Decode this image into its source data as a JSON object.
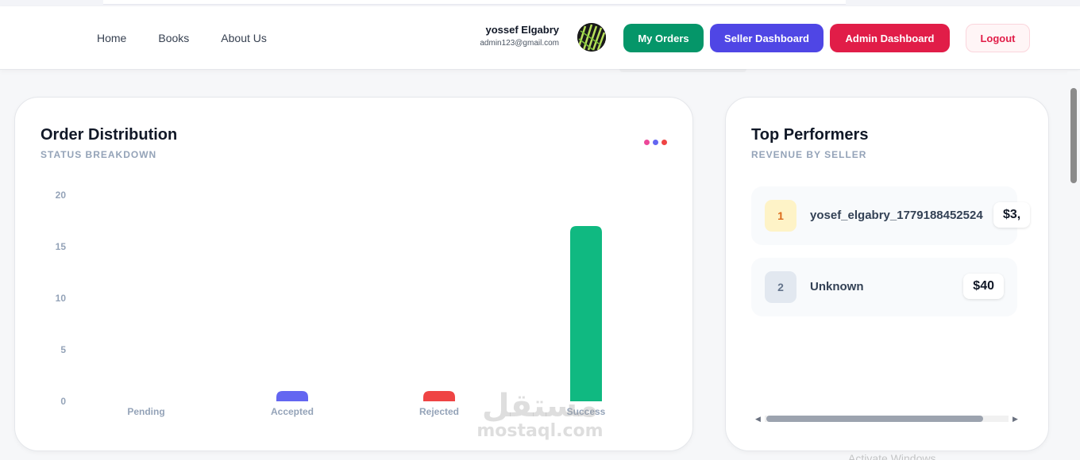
{
  "nav": {
    "links": [
      "Home",
      "Books",
      "About Us"
    ]
  },
  "user": {
    "name": "yossef Elgabry",
    "email": "admin123@gmail.com"
  },
  "buttons": {
    "my_orders": "My Orders",
    "seller_dashboard": "Seller Dashboard",
    "admin_dashboard": "Admin Dashboard",
    "logout": "Logout"
  },
  "colors": {
    "my_orders": "#059669",
    "seller_dashboard": "#4f46e5",
    "admin_dashboard": "#e11d48",
    "dots": [
      "#ec4899",
      "#6366f1",
      "#ef4444"
    ]
  },
  "order_distribution": {
    "title": "Order Distribution",
    "subtitle": "STATUS BREAKDOWN"
  },
  "chart_data": {
    "type": "bar",
    "categories": [
      "Pending",
      "Accepted",
      "Rejected",
      "Success"
    ],
    "values": [
      0,
      1,
      1,
      17
    ],
    "colors": [
      "#f59e0b",
      "#6366f1",
      "#ef4444",
      "#10b981"
    ],
    "y_ticks": [
      0,
      5,
      10,
      15,
      20
    ],
    "ylim": [
      0,
      20
    ],
    "grid": false,
    "legend": "none"
  },
  "top_performers": {
    "title": "Top Performers",
    "subtitle": "REVENUE BY SELLER",
    "items": [
      {
        "rank": "1",
        "name": "yosef_elgabry_1779188452524",
        "amount": "$3,"
      },
      {
        "rank": "2",
        "name": "Unknown",
        "amount": "$40"
      }
    ]
  },
  "watermark": {
    "arabic": "مستقل",
    "latin": "mostaql.com"
  },
  "os_overlay": "Activate Windows"
}
